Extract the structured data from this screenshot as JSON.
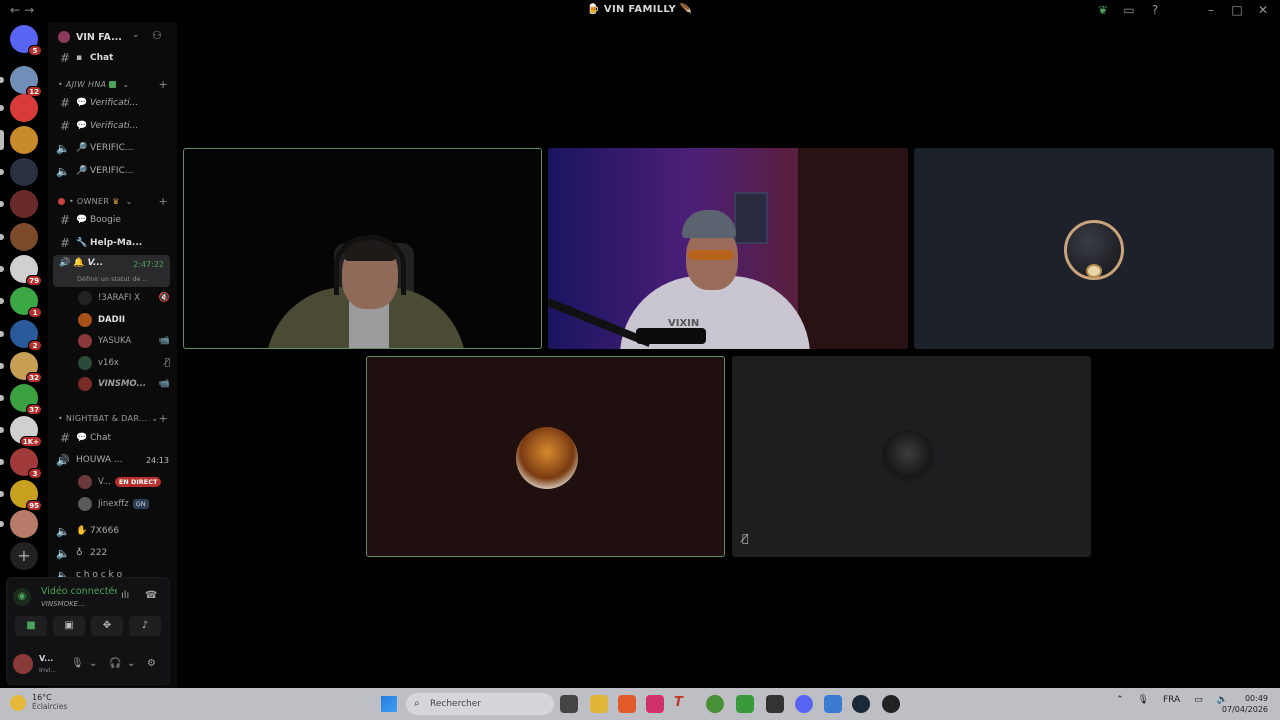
{
  "titlebar": {
    "title": "VIN FAMILLY",
    "title_prefix_emoji": "🍺",
    "title_suffix_emoji": "🪶"
  },
  "rail": {
    "servers": [
      {
        "name": "discord-home",
        "color": "#5865f2",
        "badge": "5"
      },
      {
        "name": "server-1",
        "color": "#6f8fb8",
        "badge": "12"
      },
      {
        "name": "server-2",
        "color": "#d93a3a",
        "badge": ""
      },
      {
        "name": "server-3",
        "color": "#c88a2a",
        "badge": ""
      },
      {
        "name": "server-4",
        "color": "#2c3142",
        "badge": ""
      },
      {
        "name": "server-5",
        "color": "#6a2a2a",
        "badge": ""
      },
      {
        "name": "server-6",
        "color": "#7a4a2a",
        "badge": ""
      },
      {
        "name": "server-7",
        "color": "#d0d0d0",
        "badge": "79"
      },
      {
        "name": "server-8",
        "color": "#3ca845",
        "badge": "1"
      },
      {
        "name": "server-9",
        "color": "#2a5a9a",
        "badge": "2"
      },
      {
        "name": "server-10",
        "color": "#c8a055",
        "badge": "32"
      },
      {
        "name": "server-11",
        "color": "#3aa040",
        "badge": "37"
      },
      {
        "name": "server-12",
        "color": "#d0d0d0",
        "badge": "1K+"
      },
      {
        "name": "server-13",
        "color": "#a03a3a",
        "badge": "3"
      },
      {
        "name": "server-14",
        "color": "#c8a020",
        "badge": "95"
      },
      {
        "name": "server-15",
        "color": "#b87a6a",
        "badge": ""
      }
    ]
  },
  "guild": {
    "name": "VIN FA...",
    "partial_top_channel": "Chat",
    "categories": {
      "ajiw": "AJIW HNA",
      "owner": "OWNER",
      "nightbat": "NIGHTBAT & DAR..."
    },
    "channels": {
      "verif1": "Verificati...",
      "verif2": "Verificati...",
      "verif3": "VERIFIC...",
      "verif4": "VERIFIC...",
      "boogie": "Boogie",
      "help": "Help-Ma...",
      "nb_chat": "Chat",
      "houwa": "HOUWA ...",
      "x666": "7X666",
      "c222": "222",
      "chocko": "c h o c k o"
    },
    "active_voice": {
      "name": "V...",
      "time": "2:47:22",
      "status": "Définir un statut de ..."
    },
    "active_voice_users": [
      {
        "name": "!3ARAFI X",
        "color": "#222"
      },
      {
        "name": "DADII",
        "color": "#a8501a"
      },
      {
        "name": "YASUKA",
        "color": "#8b3a3a"
      },
      {
        "name": "v16x",
        "color": "#2a4a3a"
      },
      {
        "name": "VINSMO...",
        "color": "#7a2a2a"
      }
    ],
    "houwa_time": "24:13",
    "houwa_users": [
      {
        "name": "V...",
        "color": "#6a3a3a",
        "badge": "EN DIRECT"
      },
      {
        "name": "Jinexffz",
        "color": "#5a5a5a",
        "badge": "GN"
      }
    ]
  },
  "voice_panel": {
    "status": "Vidéo connectée",
    "channel": "VINSMOKE...",
    "user_name": "V...",
    "user_status": "Invi..."
  },
  "stage": {
    "tiles": [
      {
        "id": "tile-1",
        "kind": "camera",
        "speaking": true
      },
      {
        "id": "tile-2",
        "kind": "camera",
        "speaking": false,
        "shirt_text": "VIXIN"
      },
      {
        "id": "tile-3",
        "kind": "avatar",
        "speaking": false
      },
      {
        "id": "tile-4",
        "kind": "avatar",
        "speaking": true
      },
      {
        "id": "tile-5",
        "kind": "avatar",
        "speaking": false,
        "muted": true
      }
    ]
  },
  "taskbar": {
    "temperature": "16°C",
    "weather": "Éclaircies",
    "search_placeholder": "Rechercher",
    "language": "FRA",
    "time": "00:49",
    "date": "07/04/2026"
  }
}
